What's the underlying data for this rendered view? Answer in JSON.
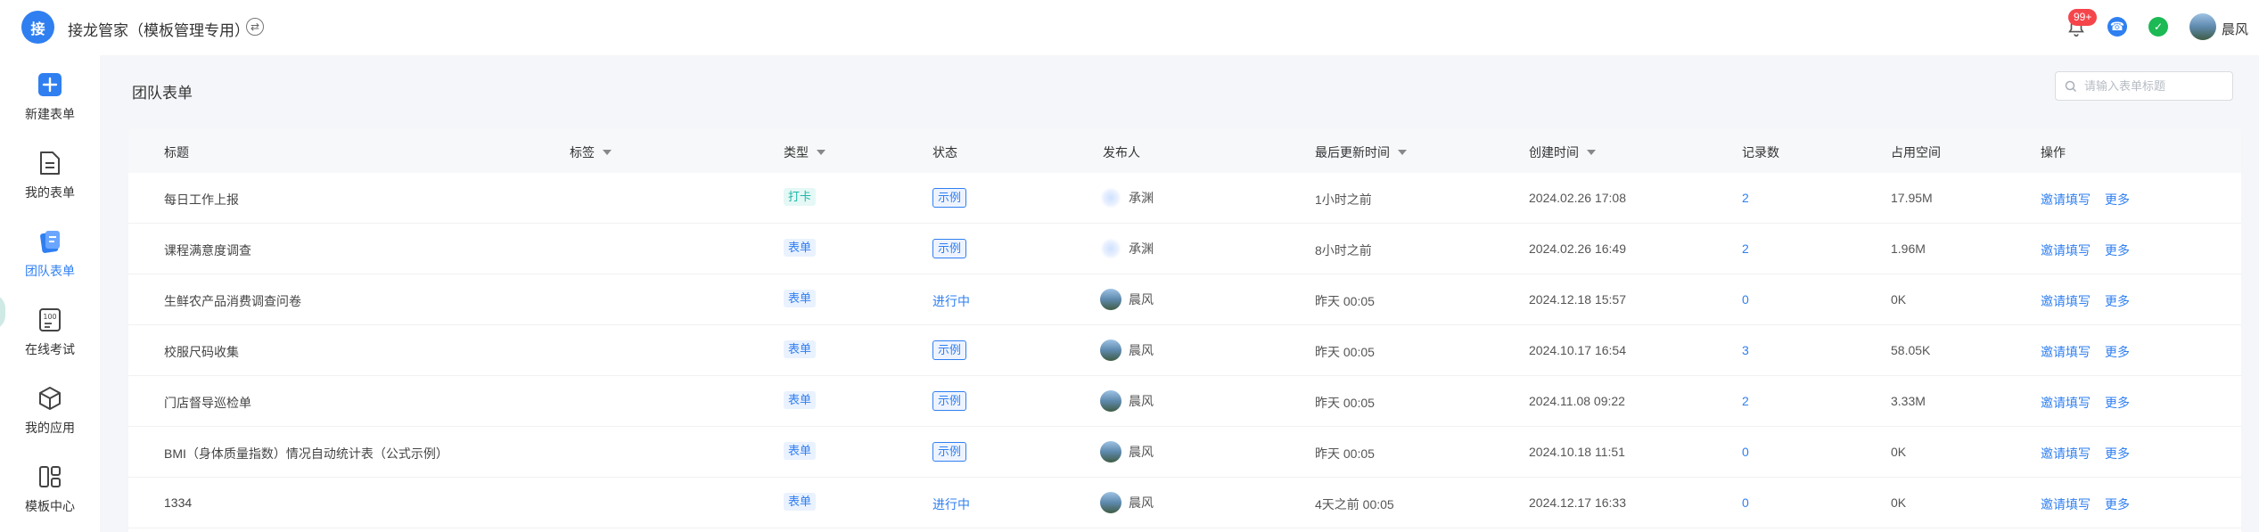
{
  "topbar": {
    "logo_char": "接",
    "app_title": "接龙管家（模板管理专用）",
    "notification_badge": "99+",
    "user_name": "晨风"
  },
  "sidebar": {
    "items": [
      {
        "label": "新建表单",
        "icon": "plus-square-icon"
      },
      {
        "label": "我的表单",
        "icon": "document-icon"
      },
      {
        "label": "团队表单",
        "icon": "team-form-icon",
        "active": true
      },
      {
        "label": "在线考试",
        "icon": "exam-100-icon"
      },
      {
        "label": "我的应用",
        "icon": "cube-icon"
      },
      {
        "label": "模板中心",
        "icon": "grid-icon"
      }
    ]
  },
  "main": {
    "page_title": "团队表单",
    "search_placeholder": "请输入表单标题"
  },
  "table": {
    "headers": {
      "title": "标题",
      "tags": "标签",
      "type": "类型",
      "status": "状态",
      "publisher": "发布人",
      "updated": "最后更新时间",
      "created": "创建时间",
      "records": "记录数",
      "space": "占用空间",
      "actions": "操作"
    },
    "action_invite": "邀请填写",
    "action_more": "更多",
    "rows": [
      {
        "title": "每日工作上报",
        "type": "打卡",
        "type_kind": "daka",
        "status": "示例",
        "status_kind": "tag",
        "publisher": "承渊",
        "avatar": "dot",
        "updated": "1小时之前",
        "created": "2024.02.26 17:08",
        "records": "2",
        "space": "17.95M"
      },
      {
        "title": "课程满意度调查",
        "type": "表单",
        "type_kind": "form",
        "status": "示例",
        "status_kind": "tag",
        "publisher": "承渊",
        "avatar": "dot",
        "updated": "8小时之前",
        "created": "2024.02.26 16:49",
        "records": "2",
        "space": "1.96M"
      },
      {
        "title": "生鲜农产品消费调查问卷",
        "type": "表单",
        "type_kind": "form",
        "status": "进行中",
        "status_kind": "text",
        "publisher": "晨风",
        "avatar": "photo",
        "updated": "昨天 00:05",
        "created": "2024.12.18 15:57",
        "records": "0",
        "space": "0K"
      },
      {
        "title": "校服尺码收集",
        "type": "表单",
        "type_kind": "form",
        "status": "示例",
        "status_kind": "tag",
        "publisher": "晨风",
        "avatar": "photo",
        "updated": "昨天 00:05",
        "created": "2024.10.17 16:54",
        "records": "3",
        "space": "58.05K"
      },
      {
        "title": "门店督导巡检单",
        "type": "表单",
        "type_kind": "form",
        "status": "示例",
        "status_kind": "tag",
        "publisher": "晨风",
        "avatar": "photo",
        "updated": "昨天 00:05",
        "created": "2024.11.08 09:22",
        "records": "2",
        "space": "3.33M"
      },
      {
        "title": "BMI（身体质量指数）情况自动统计表（公式示例）",
        "type": "表单",
        "type_kind": "form",
        "status": "示例",
        "status_kind": "tag",
        "publisher": "晨风",
        "avatar": "photo",
        "updated": "昨天 00:05",
        "created": "2024.10.18 11:51",
        "records": "0",
        "space": "0K"
      },
      {
        "title": "1334",
        "type": "表单",
        "type_kind": "form",
        "status": "进行中",
        "status_kind": "text",
        "publisher": "晨风",
        "avatar": "photo",
        "updated": "4天之前 00:05",
        "created": "2024.12.17 16:33",
        "records": "0",
        "space": "0K"
      }
    ]
  },
  "colors": {
    "primary": "#2f7ff1",
    "daka": "#1fb7a8",
    "badge": "#f5454b",
    "wechat": "#1cb954"
  }
}
